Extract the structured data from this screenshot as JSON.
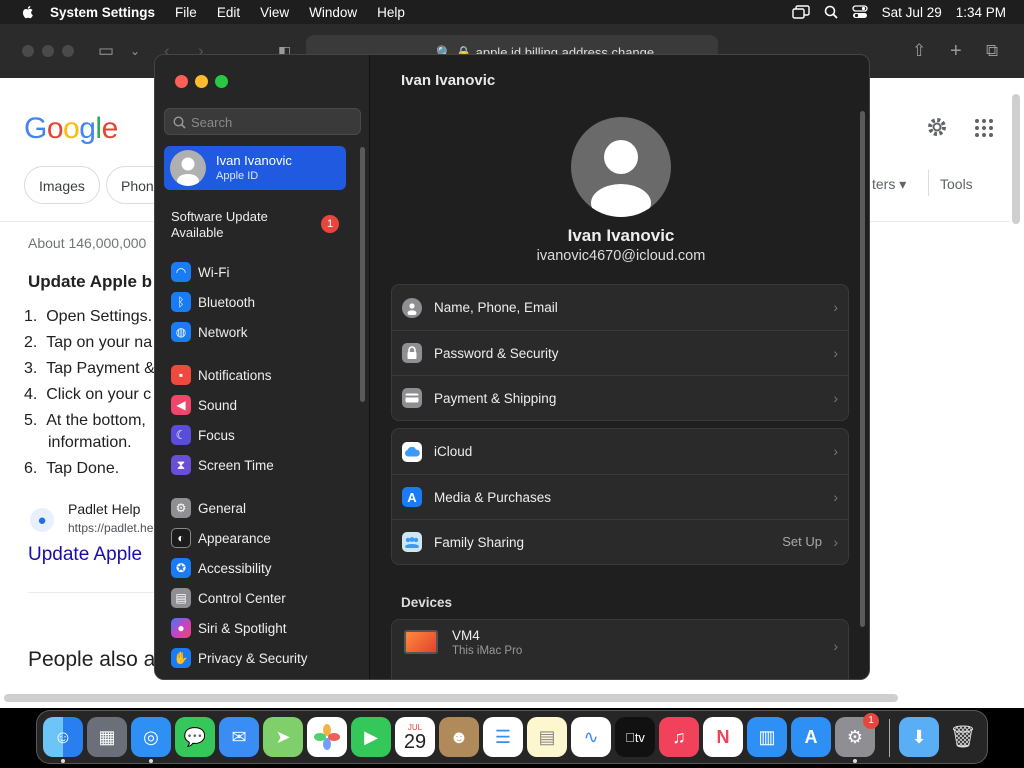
{
  "menubar": {
    "app_name": "System Settings",
    "menus": [
      "File",
      "Edit",
      "View",
      "Window",
      "Help"
    ],
    "date": "Sat Jul 29",
    "time": "1:34 PM"
  },
  "safari": {
    "url": "apple id billing address change"
  },
  "google": {
    "logo": "Google",
    "chip_images": "Images",
    "chip_phone": "Phon",
    "filters_partial": "ters",
    "tools": "Tools",
    "results_count": "About 146,000,000",
    "heading": "Update Apple b",
    "steps": [
      "Open Settings.",
      "Tap on your na",
      "Tap Payment &",
      "Click on your c",
      "At the bottom,",
      "Tap Done."
    ],
    "step5_cont": "information.",
    "source_name": "Padlet Help",
    "source_url": "https://padlet.he",
    "result_link": "Update Apple",
    "people_also": "People also a"
  },
  "sidebar": {
    "search_placeholder": "Search",
    "account_name": "Ivan Ivanovic",
    "account_sub": "Apple ID",
    "software_update": "Software Update Available",
    "software_update_badge": "1",
    "items": [
      {
        "label": "Wi-Fi",
        "icon": "wifi-icon",
        "color": "#1a7cf5"
      },
      {
        "label": "Bluetooth",
        "icon": "bluetooth-icon",
        "color": "#1a7cf5"
      },
      {
        "label": "Network",
        "icon": "globe-icon",
        "color": "#1a7cf5"
      },
      {
        "label": "Notifications",
        "icon": "bell-icon",
        "color": "#f04a3e"
      },
      {
        "label": "Sound",
        "icon": "speaker-icon",
        "color": "#f0466a"
      },
      {
        "label": "Focus",
        "icon": "moon-icon",
        "color": "#5b4ddb"
      },
      {
        "label": "Screen Time",
        "icon": "hourglass-icon",
        "color": "#6a4fd6"
      },
      {
        "label": "General",
        "icon": "gear-icon",
        "color": "#8e8e93"
      },
      {
        "label": "Appearance",
        "icon": "appearance-icon",
        "color": "#1c1c1c"
      },
      {
        "label": "Accessibility",
        "icon": "accessibility-icon",
        "color": "#1a7cf5"
      },
      {
        "label": "Control Center",
        "icon": "control-center-icon",
        "color": "#8e8e93"
      },
      {
        "label": "Siri & Spotlight",
        "icon": "siri-icon",
        "color": "#c244c9"
      },
      {
        "label": "Privacy & Security",
        "icon": "hand-icon",
        "color": "#1a7cf5"
      }
    ]
  },
  "main": {
    "title": "Ivan Ivanovic",
    "profile_name": "Ivan Ivanovic",
    "profile_email": "ivanovic4670@icloud.com",
    "group1": [
      {
        "label": "Name, Phone, Email",
        "icon": "contact-card-icon"
      },
      {
        "label": "Password & Security",
        "icon": "lock-icon"
      },
      {
        "label": "Payment & Shipping",
        "icon": "credit-card-icon"
      }
    ],
    "group2": [
      {
        "label": "iCloud",
        "icon": "icloud-icon",
        "value": ""
      },
      {
        "label": "Media & Purchases",
        "icon": "app-store-icon",
        "value": ""
      },
      {
        "label": "Family Sharing",
        "icon": "family-sharing-icon",
        "value": "Set Up"
      }
    ],
    "devices_heading": "Devices",
    "device_name": "VM4",
    "device_sub": "This iMac Pro"
  },
  "dock": {
    "calendar_month": "JUL",
    "calendar_day": "29",
    "tv_label": "tv",
    "settings_badge": "1"
  }
}
